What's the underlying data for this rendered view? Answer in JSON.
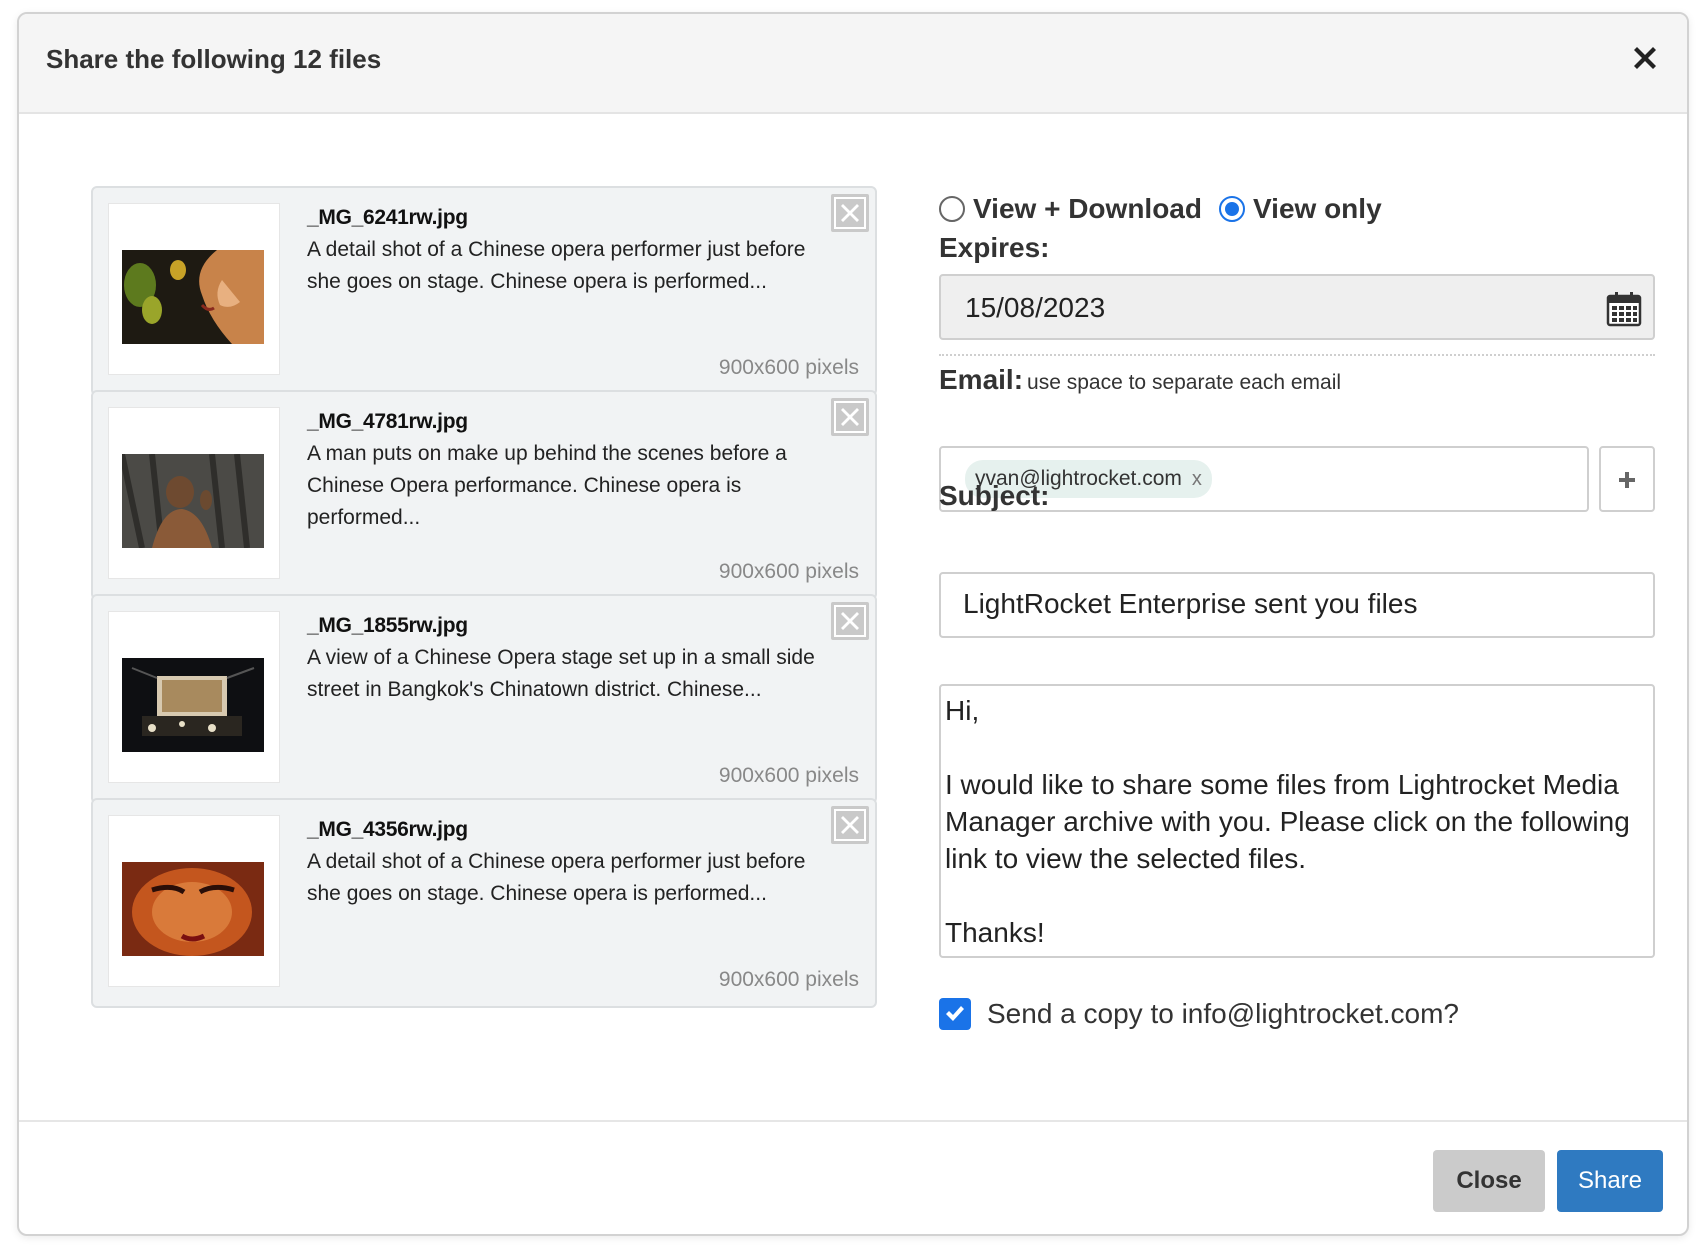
{
  "header": {
    "title": "Share the following 12 files"
  },
  "files": [
    {
      "name": "_MG_6241rw.jpg",
      "description": "A detail shot of a Chinese opera performer just before she goes on stage. Chinese opera is performed...",
      "size": "900x600 pixels"
    },
    {
      "name": "_MG_4781rw.jpg",
      "description": "A man puts on make up behind the scenes before a Chinese Opera performance. Chinese opera is performed...",
      "size": "900x600 pixels"
    },
    {
      "name": "_MG_1855rw.jpg",
      "description": "A view of a Chinese Opera stage set up in a small side street in Bangkok's Chinatown district. Chinese...",
      "size": "900x600 pixels"
    },
    {
      "name": "_MG_4356rw.jpg",
      "description": "A detail shot of a Chinese opera performer just before she goes on stage. Chinese opera is performed...",
      "size": "900x600 pixels"
    }
  ],
  "permissions": {
    "options": [
      {
        "label": "View + Download",
        "checked": false
      },
      {
        "label": "View only",
        "checked": true
      }
    ]
  },
  "expires": {
    "label": "Expires:",
    "value": "15/08/2023"
  },
  "email": {
    "label": "Email:",
    "hint": "use space to separate each email",
    "tags": [
      "yvan@lightrocket.com"
    ],
    "tag_remove": "x"
  },
  "subject": {
    "label": "Subject:",
    "value": "LightRocket Enterprise sent you files"
  },
  "message": {
    "value": "Hi,\n\nI would like to share some files from Lightrocket Media Manager archive with you. Please click on the following link to view the selected files.\n\nThanks!"
  },
  "copy": {
    "label": "Send a copy to info@lightrocket.com?",
    "checked": true
  },
  "footer": {
    "close_label": "Close",
    "share_label": "Share"
  },
  "colors": {
    "accent": "#1a73e8",
    "share_button": "#2f7ac1",
    "close_button": "#cbcbcb",
    "card_bg": "#f1f3f4"
  }
}
